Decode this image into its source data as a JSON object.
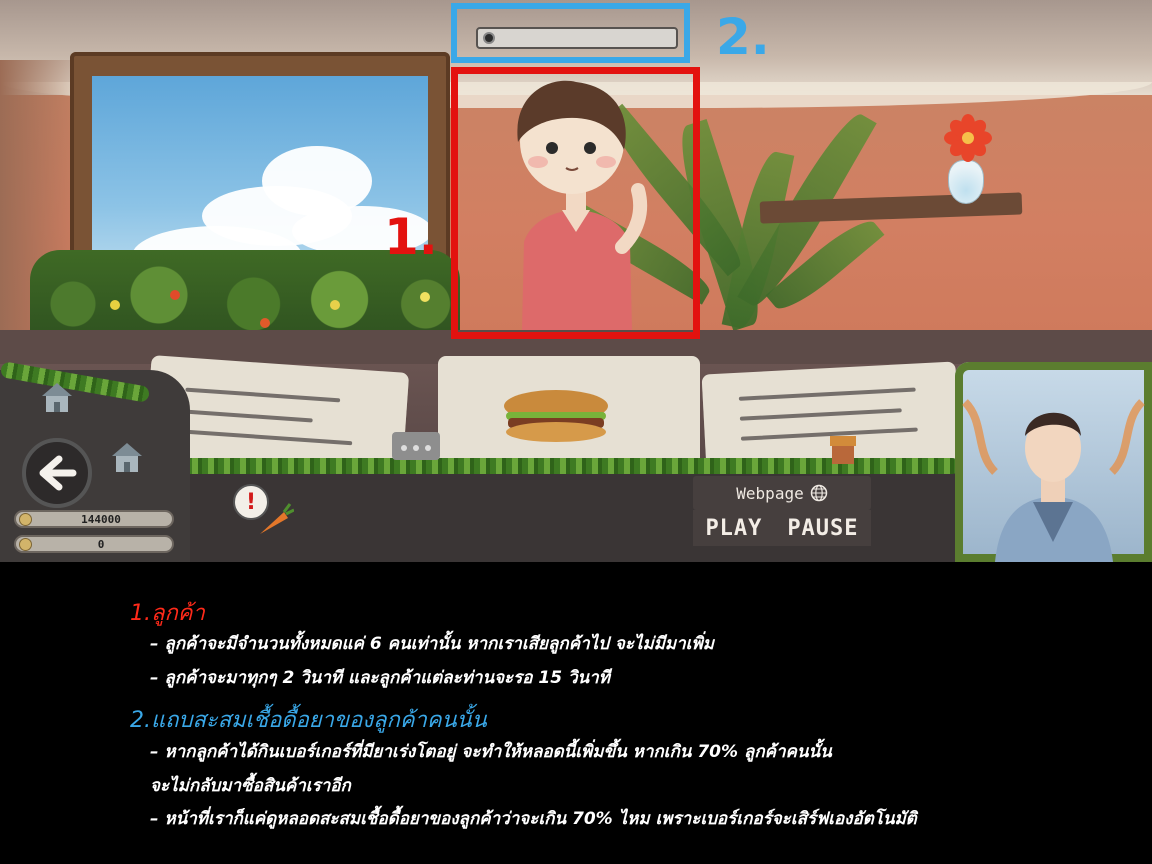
{
  "hud": {
    "infection_progress": 0.0
  },
  "annotations": {
    "label_1": "1.",
    "label_2": "2.",
    "color_1": "#e3120f",
    "color_2": "#3aa8e8"
  },
  "wallet": {
    "money": "144000",
    "second_counter": "0"
  },
  "controls": {
    "webpage_label": "Webpage",
    "webpage_icon": "globe-icon",
    "play_label": "PLAY",
    "pause_label": "PAUSE",
    "back_icon": "arrow-left-icon"
  },
  "notes": {
    "section1_title": "1.ลูกค้า",
    "section1_lines": [
      "– ลูกค้าจะมีจำนวนทั้งหมดแค่ 6 คนเท่านั้น หากเราเสียลูกค้าไป จะไม่มีมาเพิ่ม",
      "– ลูกค้าจะมาทุกๆ 2 วินาที และลูกค้าแต่ละท่านจะรอ 15 วินาที"
    ],
    "section2_title": "2.แถบสะสมเชื้อดื้อยาของลูกค้าคนนั้น",
    "section2_lines": [
      "– หากลูกค้าได้กินเบอร์เกอร์ที่มียาเร่งโตอยู่ จะทำให้หลอดนี้เพิ่มขึ้น หากเกิน 70% ลูกค้าคนนั้น",
      "จะไม่กลับมาซื้อสินค้าเราอีก",
      "– หน้าที่เราก็แค่ดูหลอดสะสมเชื้อดื้อยาของลูกค้าว่าจะเกิน 70% ไหม เพราะเบอร์เกอร์จะเสิร์ฟเองอัตโนมัติ"
    ]
  }
}
